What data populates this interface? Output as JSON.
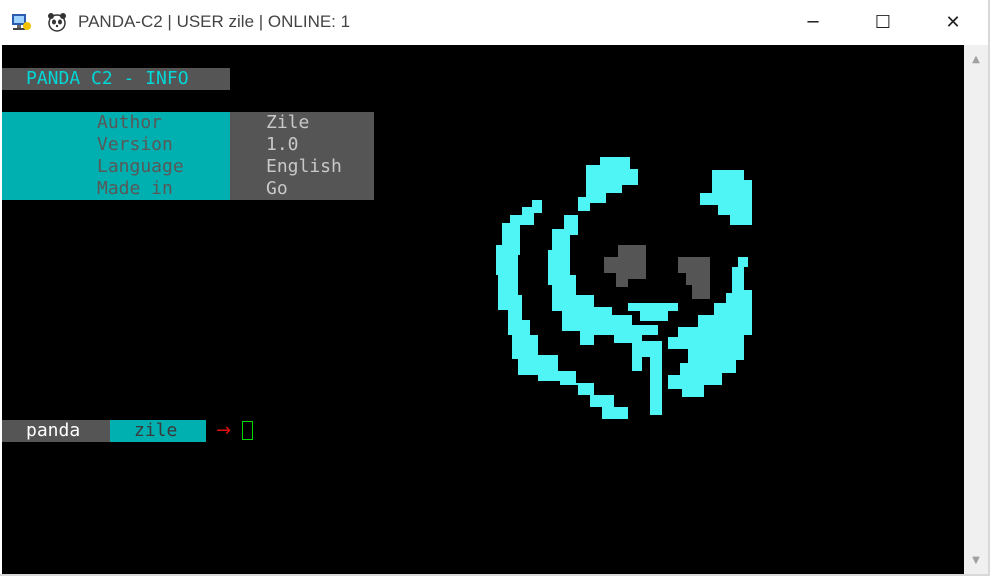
{
  "window": {
    "title": "PANDA-C2 | USER zile | ONLINE: 1",
    "app_icon": "console-app-icon",
    "panda_icon": "panda-icon",
    "controls": {
      "minimize": "─",
      "maximize": "☐",
      "close": "✕"
    }
  },
  "info": {
    "header": "PANDA C2 - INFO",
    "rows": [
      {
        "label": "Author",
        "value": "Zile"
      },
      {
        "label": "Version",
        "value": "1.0"
      },
      {
        "label": "Language",
        "value": "English"
      },
      {
        "label": "Made in",
        "value": "Go"
      }
    ]
  },
  "prompt": {
    "host": "panda",
    "user": "zile",
    "arrow": "→"
  },
  "scrollbar": {
    "up": "▲",
    "down": "▼"
  },
  "colors": {
    "cyan": "#4ff4f4",
    "teal": "#00afaf",
    "gray": "#555555",
    "background": "#000000",
    "arrow": "#e01010",
    "cursor": "#00d800"
  }
}
